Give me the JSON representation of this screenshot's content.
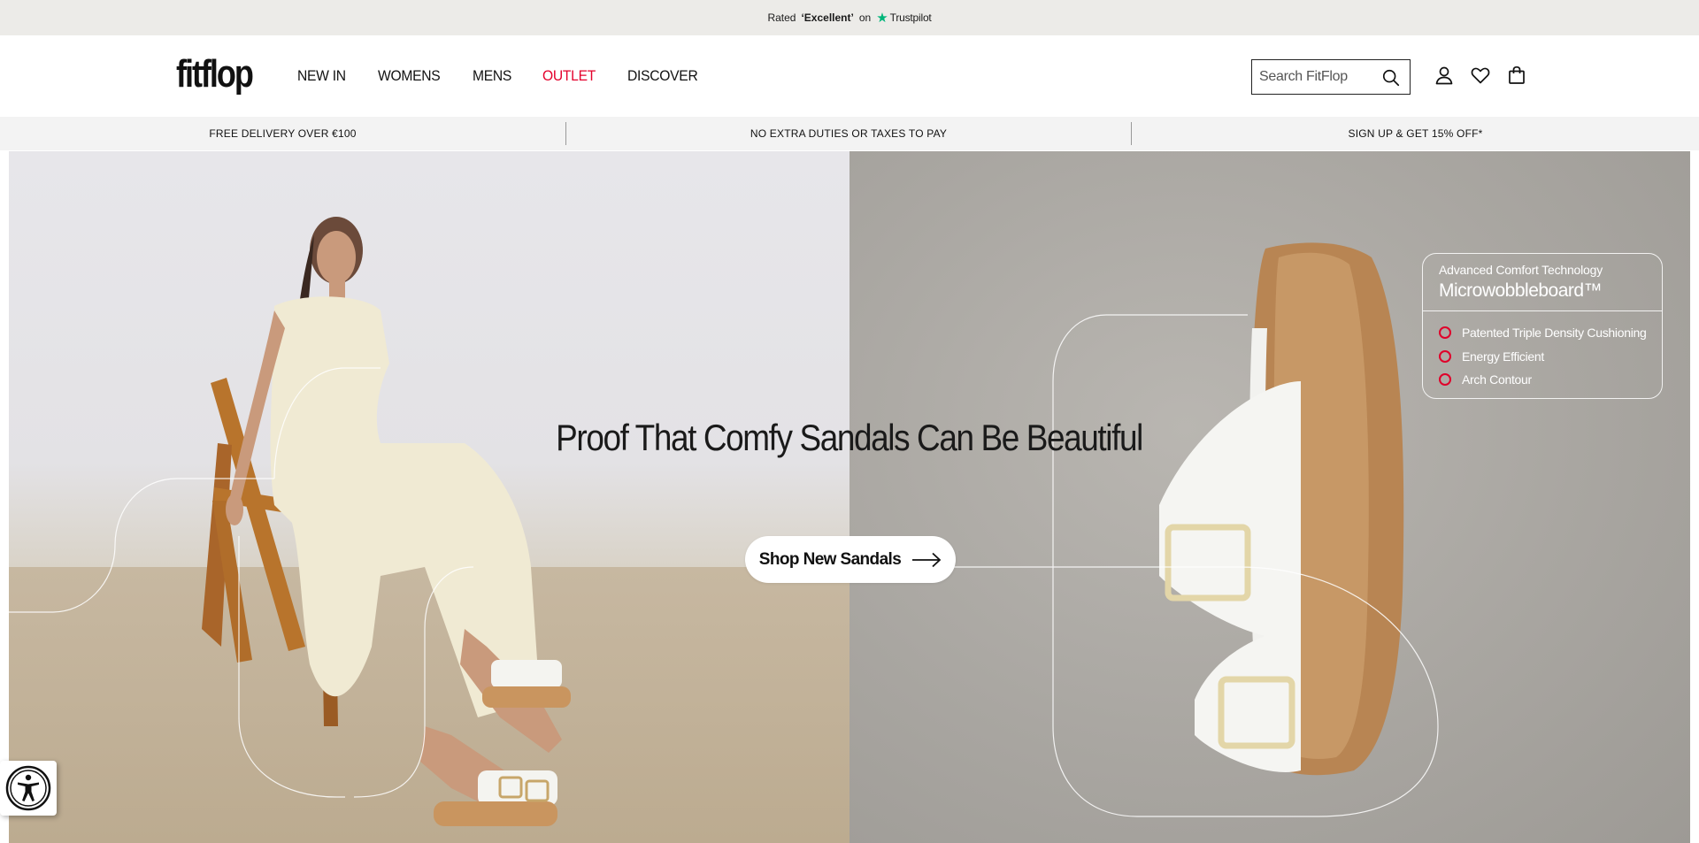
{
  "trustbar": {
    "rated": "Rated",
    "rating": "‘Excellent’",
    "on": "on",
    "provider": "Trustpilot",
    "provider_color": "#00b67a"
  },
  "header": {
    "logo": "fitflop",
    "nav": {
      "new_in": "NEW IN",
      "womens": "WOMENS",
      "mens": "MENS",
      "outlet": "OUTLET",
      "discover": "DISCOVER"
    },
    "outlet_color": "#e4002b",
    "search": {
      "placeholder": "Search FitFlop",
      "value": ""
    },
    "icons": [
      "search-icon",
      "account-icon",
      "wishlist-heart-icon",
      "shopping-bag-icon"
    ]
  },
  "promo": {
    "delivery": "FREE DELIVERY OVER €100",
    "duties": "NO EXTRA DUTIES OR TAXES TO PAY",
    "signup": "SIGN UP & GET 15% OFF*"
  },
  "hero": {
    "headline": "Proof That Comfy Sandals Can Be Beautiful",
    "cta": "Shop New Sandals",
    "tech": {
      "kicker": "Advanced Comfort Technology",
      "title": "Microwobbleboard™",
      "features": [
        "Patented Triple Density Cushioning",
        "Energy Efficient",
        "Arch Contour"
      ],
      "bullet_color": "#e0002a"
    }
  },
  "accessibility": {
    "icon": "accessibility-icon"
  }
}
